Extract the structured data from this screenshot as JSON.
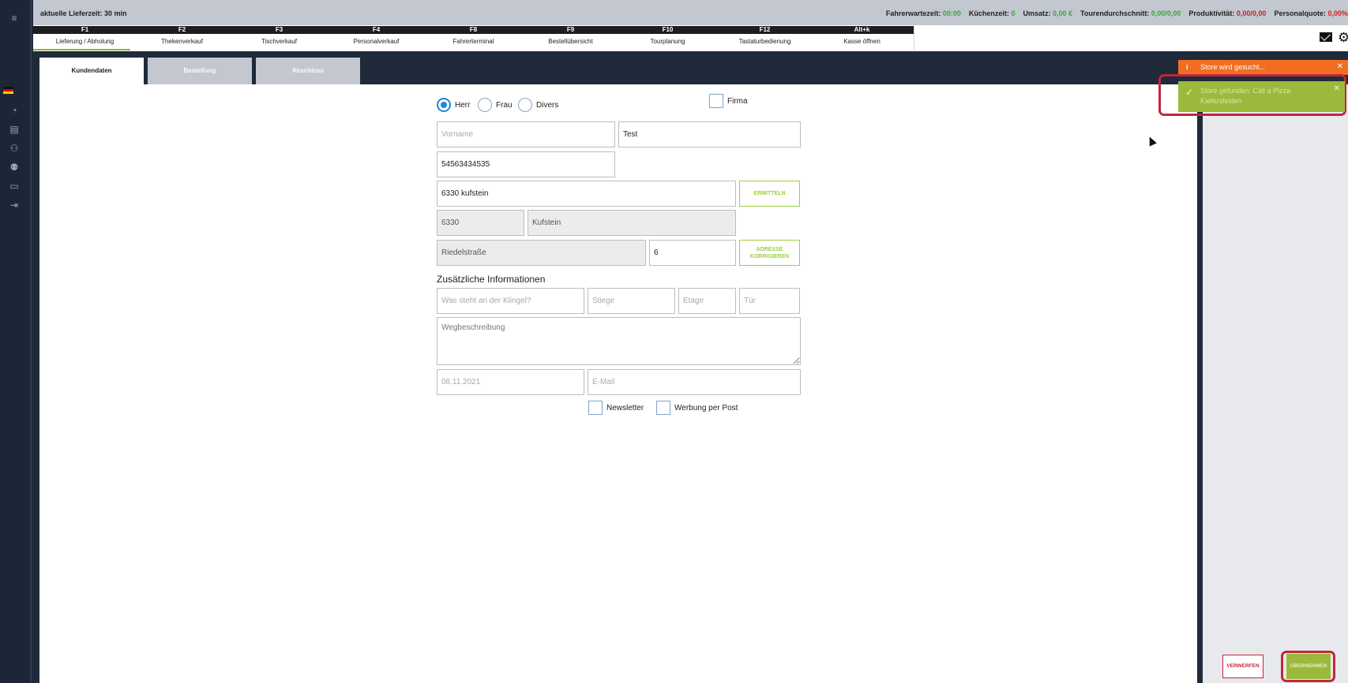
{
  "header": {
    "lieferzeit": "aktuelle Lieferzeit:  30 min",
    "stats": [
      {
        "label": "Fahrerwartezeit: ",
        "value": "00:00",
        "color": "green"
      },
      {
        "label": "Küchenzeit: ",
        "value": "0",
        "color": "green"
      },
      {
        "label": "Umsatz: ",
        "value": "0,00 €",
        "color": "green"
      },
      {
        "label": "Tourendurchschnitt: ",
        "value": "0,00/0,00",
        "color": "green"
      },
      {
        "label": "Produktivität: ",
        "value": "0,00/0,00",
        "color": "red"
      },
      {
        "label": "Personalquote: ",
        "value": "0,00%",
        "color": "red"
      }
    ]
  },
  "fkeys": [
    {
      "key": "F1",
      "label": "Lieferung / Abholung",
      "active": true
    },
    {
      "key": "F2",
      "label": "Thekenverkauf"
    },
    {
      "key": "F3",
      "label": "Tischverkauf"
    },
    {
      "key": "F4",
      "label": "Personalverkauf"
    },
    {
      "key": "F8",
      "label": "Fahrerterminal"
    },
    {
      "key": "F9",
      "label": "Bestellübersicht"
    },
    {
      "key": "F10",
      "label": "Tourplanung"
    },
    {
      "key": "F12",
      "label": "Tastaturbedienung"
    },
    {
      "key": "Alt+k",
      "label": "Kasse öffnen"
    }
  ],
  "tabs": {
    "kundendaten": "Kundendaten",
    "bestellung": "Bestellung",
    "abschluss": "Abschluss"
  },
  "form": {
    "salutation": {
      "herr": "Herr",
      "frau": "Frau",
      "divers": "Divers",
      "selected": "Herr"
    },
    "firma": "Firma",
    "vorname_placeholder": "Vorname",
    "nachname": "Test",
    "telefon": "54563434535",
    "adresse": "6330 kufstein",
    "ermitteln": "ERMITTELN",
    "plz": "6330",
    "ort": "Kufstein",
    "strasse": "Riedelstraße",
    "hausnummer": "6",
    "adresse_korrigieren": "ADRESSE KORRIGIEREN",
    "zusatz_title": "Zusätzliche Informationen",
    "klingel_placeholder": "Was steht an der Klingel?",
    "stiege_placeholder": "Stiege",
    "etage_placeholder": "Etage",
    "tuer_placeholder": "Tür",
    "wegbeschreibung_placeholder": "Wegbeschreibung",
    "datum_placeholder": "08.11.2021",
    "email_placeholder": "E-Mail",
    "newsletter": "Newsletter",
    "werbung": "Werbung per Post"
  },
  "toasts": {
    "searching": "Store wird gesucht...",
    "found": "Store gefunden: Call a Pizza Kiefersfelden"
  },
  "buttons": {
    "verwerfen": "VERWERFEN",
    "uebernehmen": "ÜBERNEHMEN"
  },
  "colors": {
    "accent_green": "#9bba3c",
    "accent_orange": "#f26d22",
    "highlight_red": "#c2273a",
    "radio_blue": "#1e88d4"
  }
}
